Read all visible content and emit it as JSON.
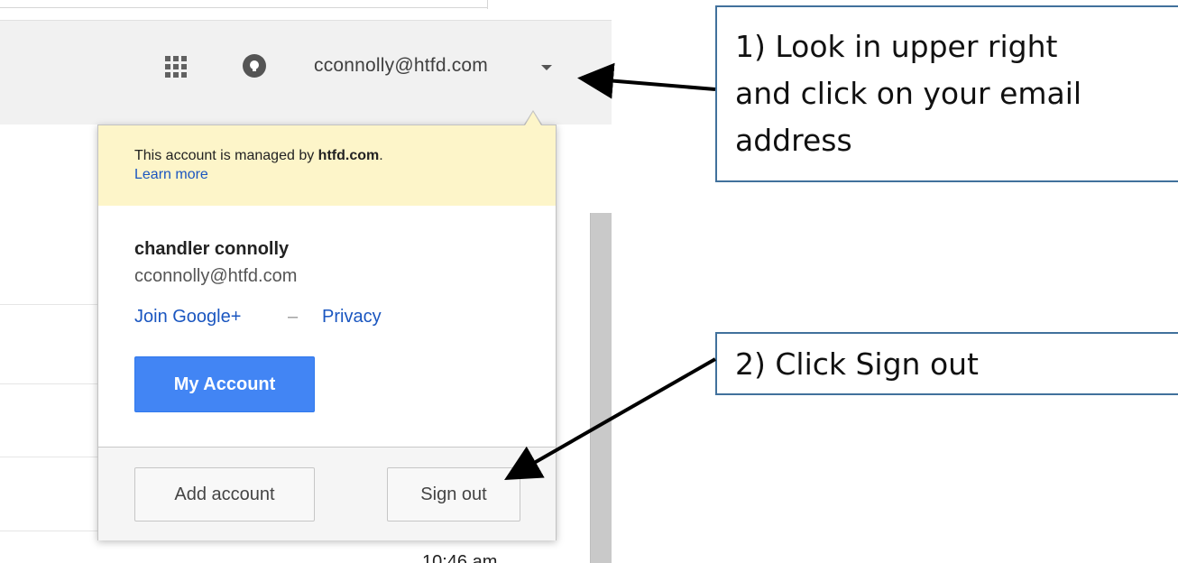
{
  "header": {
    "account_email": "cconnolly@htfd.com"
  },
  "popup": {
    "managed_prefix": "This account is managed by ",
    "managed_domain": "htfd.com",
    "managed_suffix": ".",
    "learn_more": "Learn more",
    "user_name": "chandler connolly",
    "user_email": "cconnolly@htfd.com",
    "join_google_plus": "Join Google+",
    "separator": "–",
    "privacy": "Privacy",
    "my_account_button": "My Account",
    "add_account_button": "Add account",
    "sign_out_button": "Sign out"
  },
  "background": {
    "time": "10:46 am"
  },
  "callouts": {
    "step1_line1": "1) Look in upper right",
    "step1_line2": "and click on your email",
    "step1_line3": "address",
    "step2": "2) Click Sign out"
  },
  "icons": {
    "apps": "apps-grid-icon",
    "notifications": "notifications-bell-icon",
    "dropdown": "chevron-down-icon"
  },
  "colors": {
    "primary_button": "#4285f4",
    "link": "#1a56c0",
    "managed_banner": "#fdf5c9",
    "callout_border": "#41719c"
  }
}
